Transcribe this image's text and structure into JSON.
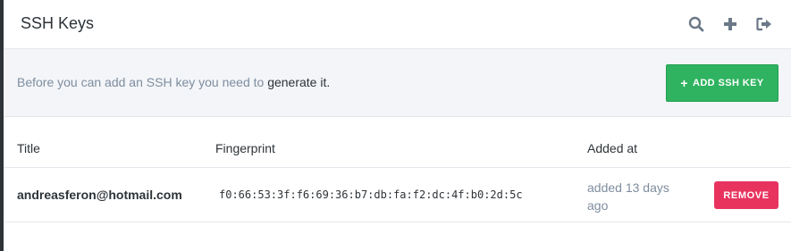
{
  "header": {
    "title": "SSH Keys",
    "actions": [
      {
        "icon": "search-icon"
      },
      {
        "icon": "plus-icon"
      },
      {
        "icon": "sign-out-icon"
      }
    ]
  },
  "notice": {
    "text": "Before you can add an SSH key you need to ",
    "link_text": "generate it.",
    "add_button_icon": "+",
    "add_button_label": "ADD SSH KEY"
  },
  "table": {
    "columns": [
      "Title",
      "Fingerprint",
      "Added at"
    ],
    "rows": [
      {
        "title": "andreasferon@hotmail.com",
        "fingerprint": "f0:66:53:3f:f6:69:36:b7:db:fa:f2:dc:4f:b0:2d:5c",
        "added_at": "added 13 days ago",
        "action_label": "REMOVE"
      }
    ]
  },
  "colors": {
    "accent_green": "#2fb360",
    "danger_red": "#e8335f",
    "muted_text": "#7e8d9f",
    "notice_bg": "#f3f5f8"
  }
}
